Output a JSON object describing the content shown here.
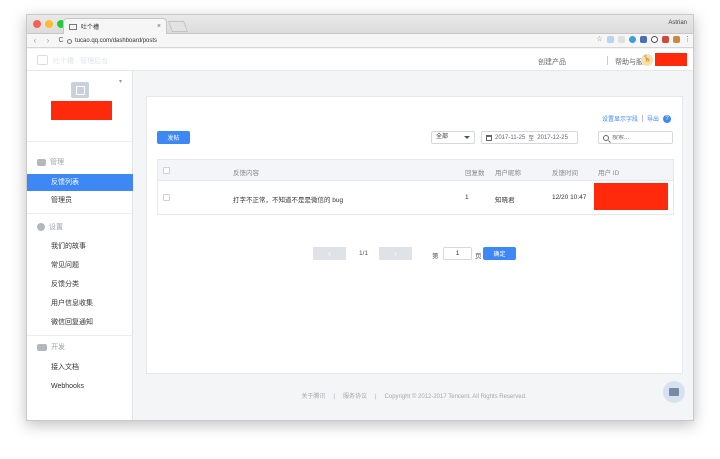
{
  "browser": {
    "tab_title": "吐个槽",
    "tab_close": "×",
    "profile": "Astrian",
    "url": "tucao.qq.com/dashboard/posts",
    "back": "‹",
    "forward": "›",
    "reload": "C"
  },
  "header": {
    "logo_text": "吐个槽 · 管理后台",
    "links": [
      "创建产品",
      "帮助与服务"
    ],
    "avatar_glyph": "🦒"
  },
  "sidebar": {
    "caret": "▾",
    "sections": [
      {
        "title": "管理",
        "items": [
          "反馈列表",
          "管理员"
        ]
      },
      {
        "title": "设置",
        "items": [
          "我们的故事",
          "常见问题",
          "反馈分类",
          "用户信息收集",
          "微信回复通知"
        ]
      },
      {
        "title": "开发",
        "items": [
          "接入文档",
          "Webhooks"
        ]
      }
    ],
    "active_item": "反馈列表"
  },
  "main": {
    "top_links": [
      "设置显示字段",
      "导出"
    ],
    "help": "?",
    "publish_label": "发帖",
    "filter_select": "全部",
    "date_start": "2017-11-25",
    "date_to": "至",
    "date_end": "2017-12-25",
    "search_placeholder": "搜索..."
  },
  "table": {
    "columns": [
      "反馈内容",
      "回复数",
      "用户昵称",
      "反馈时间",
      "用户 ID"
    ],
    "rows": [
      {
        "content": "打字不正常，不知道不是是微信的 bug",
        "replies": "1",
        "nickname": "知晓君",
        "time": "12/20 10:47",
        "user_id": ""
      }
    ]
  },
  "pagination": {
    "prev": "‹",
    "next": "›",
    "info": "1/1",
    "page_label": "第",
    "page_value": "1",
    "page_suffix": "页",
    "confirm": "确定"
  },
  "footer": {
    "items": [
      "关于腾讯",
      "|",
      "服务协议",
      "|",
      "Copyright © 2012-2017 Tencent. All Rights Reserved."
    ]
  },
  "colors": {
    "accent": "#3d88f5",
    "redaction": "#ff2a0c"
  }
}
